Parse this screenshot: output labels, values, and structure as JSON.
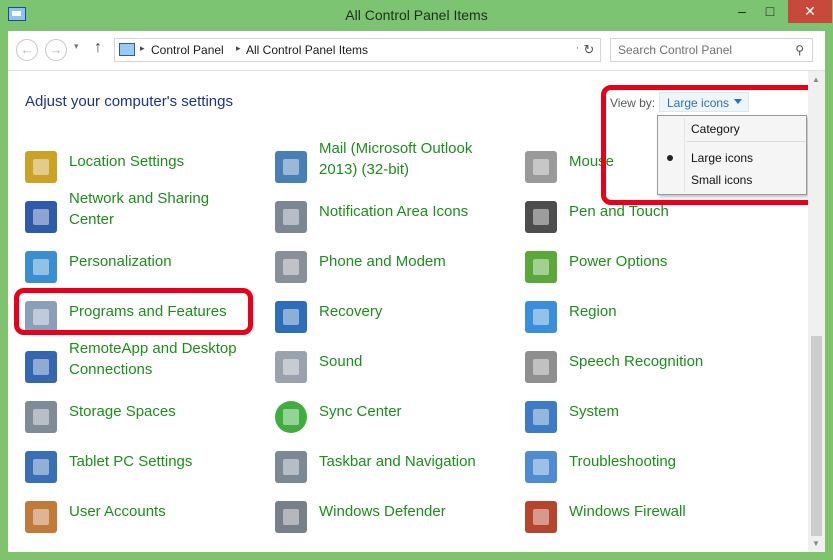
{
  "window": {
    "title": "All Control Panel Items",
    "controls": {
      "minimize": "–",
      "maximize": "□",
      "close": "✕"
    }
  },
  "nav": {
    "back_glyph": "←",
    "forward_glyph": "→",
    "recent_glyph": "▾",
    "up_glyph": "↑",
    "refresh_glyph": "↻",
    "breadcrumb": [
      "Control Panel",
      "All Control Panel Items"
    ],
    "crumb_separator": "▸",
    "dropdown_glyph": "▾",
    "search_placeholder": "Search Control Panel",
    "search_glyph": "⚲"
  },
  "header": {
    "heading": "Adjust your computer's settings",
    "view_by_label": "View by:",
    "view_by_value": "Large icons"
  },
  "view_menu": {
    "items": [
      "Category",
      "Large icons",
      "Small icons"
    ],
    "selected": "Large icons"
  },
  "items": [
    {
      "label": "Location Settings",
      "icon": "location-icon",
      "color": "#c9a227",
      "highlighted": false
    },
    {
      "label": "Mail (Microsoft Outlook 2013) (32-bit)",
      "icon": "mail-icon",
      "color": "#4a7fb5",
      "highlighted": false
    },
    {
      "label": "Mouse",
      "icon": "mouse-icon",
      "color": "#9a9a9a",
      "highlighted": false
    },
    {
      "label": "Network and Sharing Center",
      "icon": "network-icon",
      "color": "#2f5aa8",
      "highlighted": false
    },
    {
      "label": "Notification Area Icons",
      "icon": "notification-icon",
      "color": "#7d8794",
      "highlighted": false
    },
    {
      "label": "Pen and Touch",
      "icon": "pen-icon",
      "color": "#4d4d4d",
      "highlighted": false
    },
    {
      "label": "Personalization",
      "icon": "personalization-icon",
      "color": "#3b8fd0",
      "highlighted": false
    },
    {
      "label": "Phone and Modem",
      "icon": "phone-icon",
      "color": "#8a9099",
      "highlighted": false
    },
    {
      "label": "Power Options",
      "icon": "power-icon",
      "color": "#5aa83a",
      "highlighted": false
    },
    {
      "label": "Programs and Features",
      "icon": "programs-icon",
      "color": "#8aa0b8",
      "highlighted": true
    },
    {
      "label": "Recovery",
      "icon": "recovery-icon",
      "color": "#2e6db8",
      "highlighted": false
    },
    {
      "label": "Region",
      "icon": "region-icon",
      "color": "#3a8fd8",
      "highlighted": false
    },
    {
      "label": "RemoteApp and Desktop Connections",
      "icon": "remoteapp-icon",
      "color": "#3566b0",
      "highlighted": false
    },
    {
      "label": "Sound",
      "icon": "sound-icon",
      "color": "#9aa3ad",
      "highlighted": false
    },
    {
      "label": "Speech Recognition",
      "icon": "speech-icon",
      "color": "#8f8f8f",
      "highlighted": false
    },
    {
      "label": "Storage Spaces",
      "icon": "storage-icon",
      "color": "#7f8b97",
      "highlighted": false
    },
    {
      "label": "Sync Center",
      "icon": "sync-icon",
      "color": "#3fae3f",
      "highlighted": false
    },
    {
      "label": "System",
      "icon": "system-icon",
      "color": "#3d7cc4",
      "highlighted": false
    },
    {
      "label": "Tablet PC Settings",
      "icon": "tablet-icon",
      "color": "#3a6fb6",
      "highlighted": false
    },
    {
      "label": "Taskbar and Navigation",
      "icon": "taskbar-icon",
      "color": "#7b8896",
      "highlighted": false
    },
    {
      "label": "Troubleshooting",
      "icon": "troubleshooting-icon",
      "color": "#4f8ccf",
      "highlighted": false
    },
    {
      "label": "User Accounts",
      "icon": "user-accounts-icon",
      "color": "#c07a3a",
      "highlighted": false
    },
    {
      "label": "Windows Defender",
      "icon": "defender-icon",
      "color": "#777f88",
      "highlighted": false
    },
    {
      "label": "Windows Firewall",
      "icon": "firewall-icon",
      "color": "#b5462d",
      "highlighted": false
    }
  ],
  "theme": {
    "accent": "#7fc36f",
    "link_color": "#1e8c1e",
    "heading_color": "#1e3287",
    "highlight_color": "#e8001a"
  }
}
